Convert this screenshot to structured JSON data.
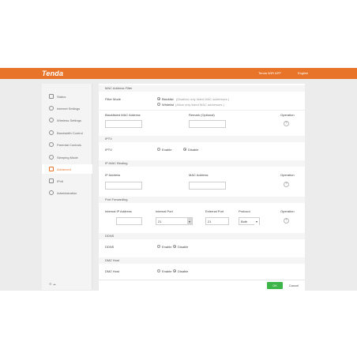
{
  "header": {
    "logo": "Tenda",
    "app_link": "Tenda WiFi APP",
    "language": "English"
  },
  "sidebar": {
    "items": [
      {
        "label": "Status",
        "icon": "status-icon"
      },
      {
        "label": "Internet Settings",
        "icon": "globe-icon"
      },
      {
        "label": "Wireless Settings",
        "icon": "wifi-icon"
      },
      {
        "label": "Bandwidth Control",
        "icon": "gauge-icon"
      },
      {
        "label": "Parental Controls",
        "icon": "parental-icon"
      },
      {
        "label": "Sleeping Mode",
        "icon": "sleep-icon"
      },
      {
        "label": "Advanced",
        "icon": "advanced-icon",
        "active": true
      },
      {
        "label": "IPv6",
        "icon": "ipv6-icon"
      },
      {
        "label": "Administration",
        "icon": "gear-icon"
      }
    ],
    "footer": "⚙ ☁"
  },
  "mac_filter": {
    "title": "MAC Address Filter",
    "filter_mode_label": "Filter Mode",
    "blacklist_label": "Blacklist",
    "blacklist_hint": "(Disallow only listed MAC addresses.)",
    "whitelist_label": "Whitelist",
    "whitelist_hint": "(Allow only listed MAC addresses.)",
    "col_mac": "Blacklisted MAC Address",
    "col_remark": "Remark (Optional)",
    "col_operation": "Operation"
  },
  "iptv": {
    "title": "IPTV",
    "label": "IPTV",
    "enable": "Enable",
    "disable": "Disable"
  },
  "ip_mac": {
    "title": "IP-MAC Binding",
    "col_ip": "IP Address",
    "col_mac": "MAC Address",
    "col_operation": "Operation"
  },
  "port_forwarding": {
    "title": "Port Forwarding",
    "col_internal_ip": "Internal IP Address",
    "col_internal_port": "Internal Port",
    "col_external_port": "External Port",
    "col_protocol": "Protocol",
    "col_operation": "Operation",
    "internal_port_value": "21",
    "external_port_value": "21",
    "protocol_value": "Both"
  },
  "ddns": {
    "title": "DDNS",
    "label": "DDNS",
    "enable": "Enable",
    "disable": "Disable"
  },
  "dmz": {
    "title": "DMZ Host",
    "label": "DMZ Host",
    "enable": "Enable",
    "disable": "Disable"
  },
  "buttons": {
    "ok": "OK",
    "cancel": "Cancel"
  }
}
